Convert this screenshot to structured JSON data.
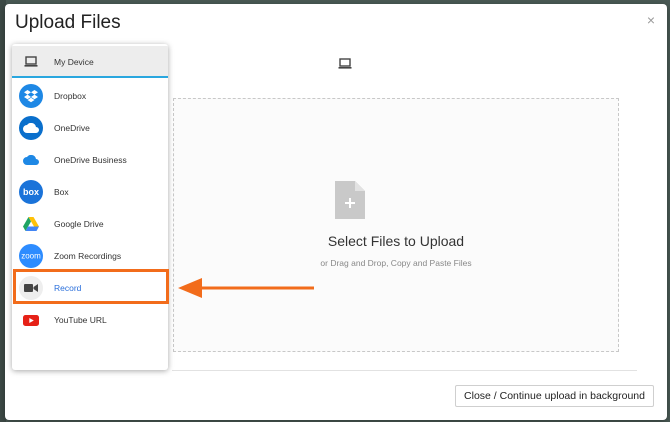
{
  "modal": {
    "title": "Upload Files",
    "close_label": "×",
    "footer_button_label": "Close / Continue upload in background"
  },
  "dropzone": {
    "title": "Select Files to Upload",
    "subtitle": "or Drag and Drop, Copy and Paste Files"
  },
  "sources": [
    {
      "label": "My Device",
      "icon": "laptop-icon",
      "active": true
    },
    {
      "label": "Dropbox",
      "icon": "dropbox-icon",
      "color": "#1e88e5"
    },
    {
      "label": "OneDrive",
      "icon": "onedrive-icon",
      "color": "#0a6fcc"
    },
    {
      "label": "OneDrive Business",
      "icon": "onedrive-business-icon",
      "color": "#1e88e5"
    },
    {
      "label": "Box",
      "icon": "box-icon",
      "color": "#1a73d9"
    },
    {
      "label": "Google Drive",
      "icon": "google-drive-icon"
    },
    {
      "label": "Zoom Recordings",
      "icon": "zoom-icon",
      "color": "#2d8cff"
    },
    {
      "label": "Record",
      "icon": "video-camera-icon",
      "highlighted": true
    },
    {
      "label": "YouTube URL",
      "icon": "youtube-icon",
      "color": "#e62117"
    }
  ],
  "colors": {
    "accent": "#2aa7df",
    "highlight": "#f26c1b",
    "record_label": "#2a6fdb"
  }
}
